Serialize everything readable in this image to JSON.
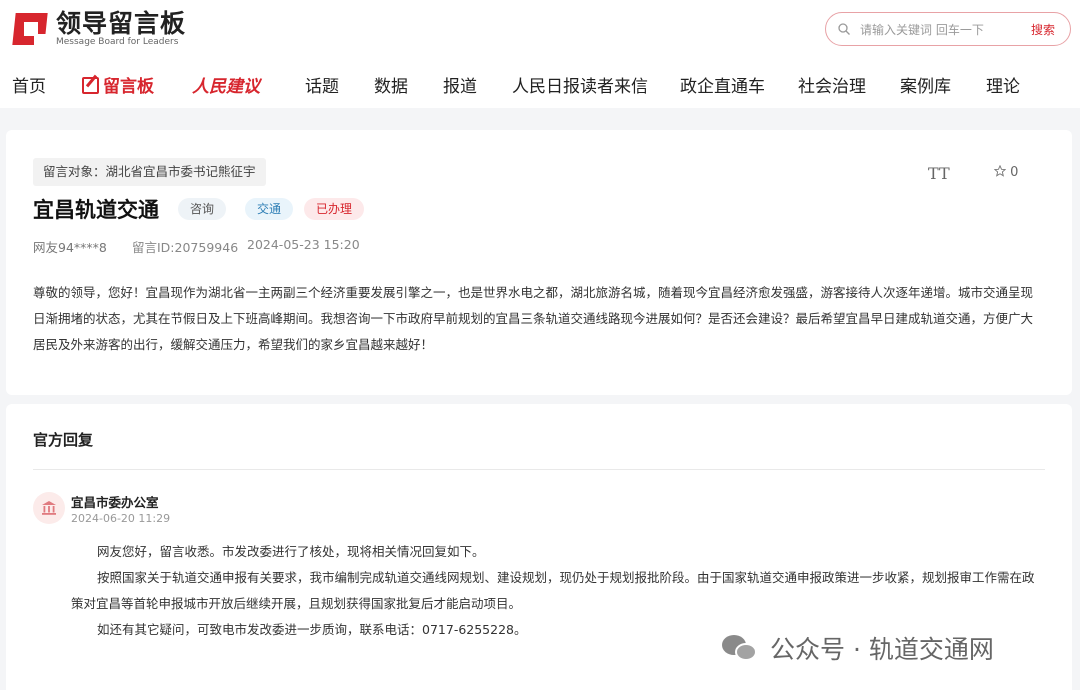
{
  "header": {
    "logo_title": "领导留言板",
    "logo_subtitle": "Message Board for Leaders",
    "search": {
      "placeholder": "请输入关键词 回车一下",
      "button_label": "搜索"
    }
  },
  "nav": {
    "items": [
      {
        "label": "首页"
      },
      {
        "label": "留言板",
        "active": true
      },
      {
        "label": "人民建议"
      },
      {
        "label": "话题"
      },
      {
        "label": "数据"
      },
      {
        "label": "报道"
      },
      {
        "label": "人民日报读者来信"
      },
      {
        "label": "政企直通车"
      },
      {
        "label": "社会治理"
      },
      {
        "label": "案例库"
      },
      {
        "label": "理论"
      }
    ]
  },
  "message": {
    "target": "留言对象：湖北省宜昌市委书记熊征宇",
    "font_toggle": "TT",
    "star_count": "0",
    "title": "宜昌轨道交通",
    "tags": {
      "category": "咨询",
      "field": "交通",
      "status": "已办理"
    },
    "author": "网友94****8",
    "message_id": "留言ID:20759946",
    "time": "2024-05-23 15:20",
    "content": "尊敬的领导，您好！宜昌现作为湖北省一主两副三个经济重要发展引擎之一，也是世界水电之都，湖北旅游名城，随着现今宜昌经济愈发强盛，游客接待人次逐年递增。城市交通呈现日渐拥堵的状态，尤其在节假日及上下班高峰期间。我想咨询一下市政府早前规划的宜昌三条轨道交通线路现今进展如何？是否还会建设？最后希望宜昌早日建成轨道交通，方便广大居民及外来游客的出行，缓解交通压力，希望我们的家乡宜昌越来越好！"
  },
  "reply": {
    "section_title": "官方回复",
    "department": "宜昌市委办公室",
    "time": "2024-06-20 11:29",
    "paragraphs": [
      "网友您好，留言收悉。市发改委进行了核处，现将相关情况回复如下。",
      "按照国家关于轨道交通申报有关要求，我市编制完成轨道交通线网规划、建设规划，现仍处于规划报批阶段。由于国家轨道交通申报政策进一步收紧，规划报审工作需在政策对宜昌等首轮申报城市开放后继续开展，且规划获得国家批复后才能启动项目。",
      "如还有其它疑问，可致电市发改委进一步质询，联系电话：0717-6255228。"
    ]
  },
  "watermark": {
    "text": "公众号 · 轨道交通网"
  },
  "colors": {
    "brand_red": "#d7262e",
    "tag_blue": "#2f7fb6",
    "page_bg": "#f4f5f7"
  },
  "icons": [
    "search-icon",
    "font-size-icon",
    "star-icon",
    "government-building-icon",
    "wechat-icon",
    "message-board-pen-icon"
  ]
}
